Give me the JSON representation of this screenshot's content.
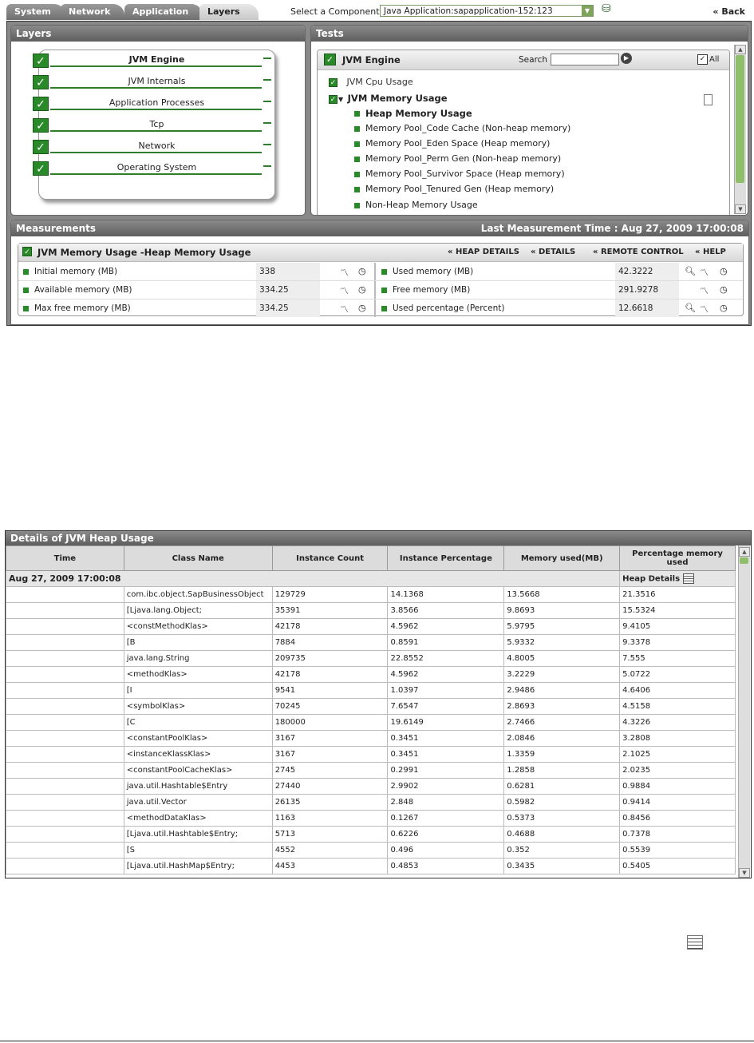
{
  "tabs": [
    {
      "label": "System"
    },
    {
      "label": "Network"
    },
    {
      "label": "Application"
    },
    {
      "label": "Layers"
    }
  ],
  "component": {
    "label": "Select a Component",
    "value": "Java Application:sapapplication-152:123"
  },
  "back_label": "Back",
  "layers": {
    "title": "Layers",
    "items": [
      {
        "label": "JVM Engine"
      },
      {
        "label": "JVM Internals"
      },
      {
        "label": "Application Processes"
      },
      {
        "label": "Tcp"
      },
      {
        "label": "Network"
      },
      {
        "label": "Operating System"
      }
    ]
  },
  "tests": {
    "title": "Tests",
    "header": "JVM Engine",
    "search_label": "Search",
    "all_label": "All",
    "cpu": "JVM Cpu Usage",
    "memory": "JVM Memory Usage",
    "sub": [
      {
        "label": "Heap Memory Usage"
      },
      {
        "label": "Memory Pool_Code Cache (Non-heap memory)"
      },
      {
        "label": "Memory Pool_Eden Space (Heap memory)"
      },
      {
        "label": "Memory Pool_Perm Gen (Non-heap memory)"
      },
      {
        "label": "Memory Pool_Survivor Space (Heap memory)"
      },
      {
        "label": "Memory Pool_Tenured Gen (Heap memory)"
      },
      {
        "label": "Non-Heap Memory Usage"
      }
    ]
  },
  "measurements": {
    "title": "Measurements",
    "last_time": "Last Measurement Time : Aug 27, 2009 17:00:08",
    "test_title": "JVM Memory Usage -Heap Memory Usage",
    "actions": {
      "heap": "HEAP DETAILS",
      "details": "DETAILS",
      "remote": "REMOTE CONTROL",
      "help": "HELP"
    },
    "rows": [
      {
        "l_label": "Initial memory (MB)",
        "l_value": "338",
        "r_label": "Used memory (MB)",
        "r_value": "42.3222"
      },
      {
        "l_label": "Available memory (MB)",
        "l_value": "334.25",
        "r_label": "Free memory (MB)",
        "r_value": "291.9278"
      },
      {
        "l_label": "Max free memory (MB)",
        "l_value": "334.25",
        "r_label": "Used percentage (Percent)",
        "r_value": "12.6618"
      }
    ]
  },
  "heap": {
    "title": "Details of JVM Heap Usage",
    "columns": [
      "Time",
      "Class Name",
      "Instance Count",
      "Instance Percentage",
      "Memory used(MB)",
      "Percentage memory used"
    ],
    "date": "Aug 27, 2009 17:00:08",
    "heap_details_label": "Heap Details",
    "rows": [
      [
        "com.ibc.object.SapBusinessObject",
        "129729",
        "14.1368",
        "13.5668",
        "21.3516"
      ],
      [
        "[Ljava.lang.Object;",
        "35391",
        "3.8566",
        "9.8693",
        "15.5324"
      ],
      [
        "<constMethodKlas>",
        "42178",
        "4.5962",
        "5.9795",
        "9.4105"
      ],
      [
        "[B",
        "7884",
        "0.8591",
        "5.9332",
        "9.3378"
      ],
      [
        "java.lang.String",
        "209735",
        "22.8552",
        "4.8005",
        "7.555"
      ],
      [
        "<methodKlas>",
        "42178",
        "4.5962",
        "3.2229",
        "5.0722"
      ],
      [
        "[I",
        "9541",
        "1.0397",
        "2.9486",
        "4.6406"
      ],
      [
        "<symbolKlas>",
        "70245",
        "7.6547",
        "2.8693",
        "4.5158"
      ],
      [
        "[C",
        "180000",
        "19.6149",
        "2.7466",
        "4.3226"
      ],
      [
        "<constantPoolKlas>",
        "3167",
        "0.3451",
        "2.0846",
        "3.2808"
      ],
      [
        "<instanceKlassKlas>",
        "3167",
        "0.3451",
        "1.3359",
        "2.1025"
      ],
      [
        "<constantPoolCacheKlas>",
        "2745",
        "0.2991",
        "1.2858",
        "2.0235"
      ],
      [
        "java.util.Hashtable$Entry",
        "27440",
        "2.9902",
        "0.6281",
        "0.9884"
      ],
      [
        "java.util.Vector",
        "26135",
        "2.848",
        "0.5982",
        "0.9414"
      ],
      [
        "<methodDataKlas>",
        "1163",
        "0.1267",
        "0.5373",
        "0.8456"
      ],
      [
        "[Ljava.util.Hashtable$Entry;",
        "5713",
        "0.6226",
        "0.4688",
        "0.7378"
      ],
      [
        "[S",
        "4552",
        "0.496",
        "0.352",
        "0.5539"
      ],
      [
        "[Ljava.util.HashMap$Entry;",
        "4453",
        "0.4853",
        "0.3435",
        "0.5405"
      ]
    ]
  }
}
